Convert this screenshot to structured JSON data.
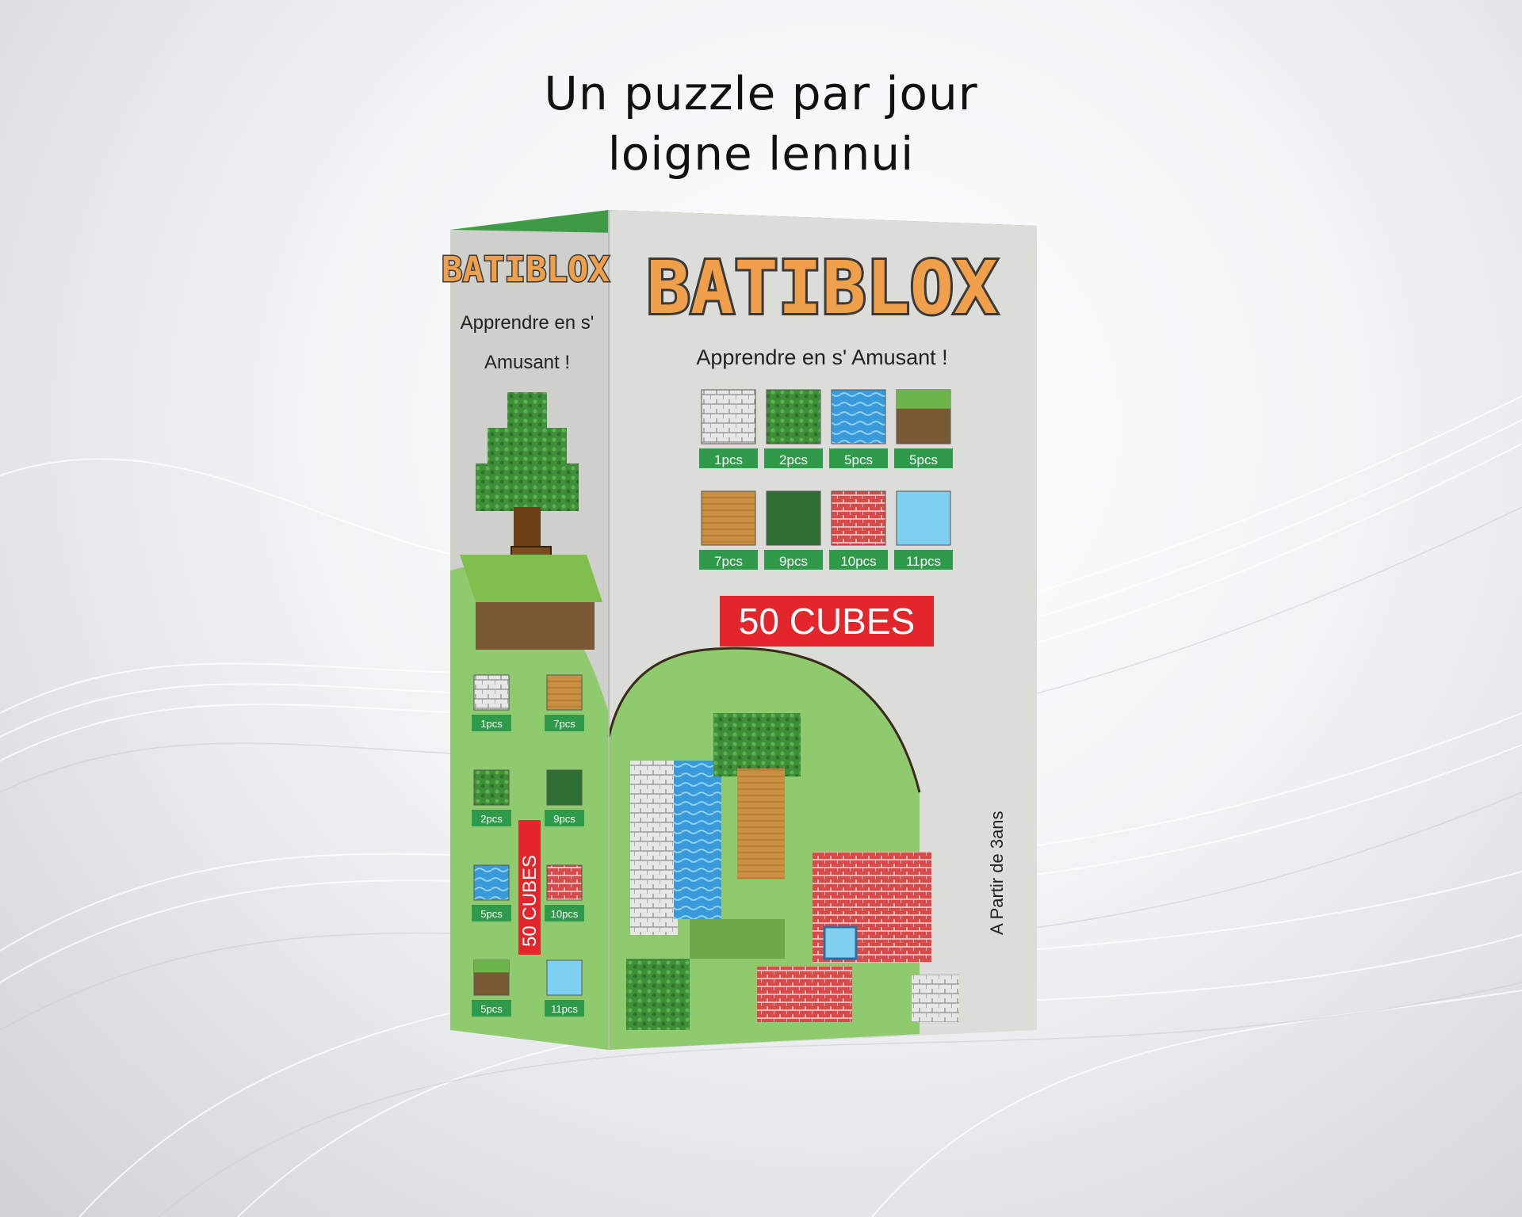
{
  "headline": {
    "line1": "Un puzzle par jour",
    "line2": "loigne lennui"
  },
  "box": {
    "brand": "BATIBLOX",
    "tagline": "Apprendre en s' Amusant !",
    "side_tagline_line1": "Apprendre en s'",
    "side_tagline_line2": "Amusant !",
    "cube_count_label": "50 CUBES",
    "side_cube_count_label": "50 CUBES",
    "age_label": "A Partir de 3ans",
    "front_cubes": [
      {
        "label": "1pcs",
        "type": "stone-icon"
      },
      {
        "label": "2pcs",
        "type": "leaves-icon"
      },
      {
        "label": "5pcs",
        "type": "water-icon"
      },
      {
        "label": "5pcs",
        "type": "grass-icon"
      },
      {
        "label": "7pcs",
        "type": "wood-icon"
      },
      {
        "label": "9pcs",
        "type": "dark-leaves-icon"
      },
      {
        "label": "10pcs",
        "type": "brick-icon"
      },
      {
        "label": "11pcs",
        "type": "glass-icon"
      }
    ],
    "side_cubes": [
      {
        "label": "1pcs",
        "type": "stone-icon"
      },
      {
        "label": "7pcs",
        "type": "wood-icon"
      },
      {
        "label": "2pcs",
        "type": "leaves-icon"
      },
      {
        "label": "9pcs",
        "type": "dark-leaves-icon"
      },
      {
        "label": "5pcs",
        "type": "water-icon"
      },
      {
        "label": "10pcs",
        "type": "brick-icon"
      },
      {
        "label": "5pcs",
        "type": "grass-icon"
      },
      {
        "label": "11pcs",
        "type": "glass-icon"
      }
    ]
  },
  "colors": {
    "box_grey": "#dcdcd8",
    "box_side": "#cfd0cb",
    "accent_green": "#8fca6e",
    "badge_green": "#2f9a4a",
    "cubes_red": "#e3262b",
    "logo_orange": "#f0a04b",
    "logo_dark": "#3a3a3a"
  }
}
